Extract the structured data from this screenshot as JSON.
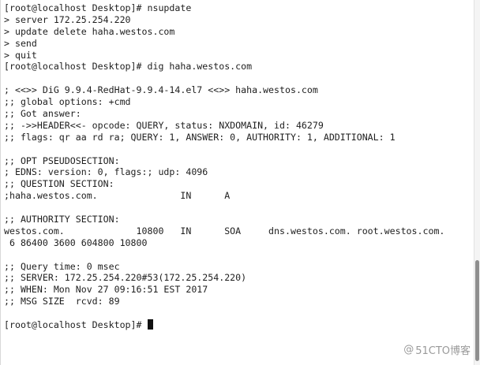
{
  "terminal": {
    "lines": [
      "[root@localhost Desktop]# nsupdate",
      "> server 172.25.254.220",
      "> update delete haha.westos.com",
      "> send",
      "> quit",
      "[root@localhost Desktop]# dig haha.westos.com",
      "",
      "; <<>> DiG 9.9.4-RedHat-9.9.4-14.el7 <<>> haha.westos.com",
      ";; global options: +cmd",
      ";; Got answer:",
      ";; ->>HEADER<<- opcode: QUERY, status: NXDOMAIN, id: 46279",
      ";; flags: qr aa rd ra; QUERY: 1, ANSWER: 0, AUTHORITY: 1, ADDITIONAL: 1",
      "",
      ";; OPT PSEUDOSECTION:",
      "; EDNS: version: 0, flags:; udp: 4096",
      ";; QUESTION SECTION:",
      ";haha.westos.com.\t\tIN\tA",
      "",
      ";; AUTHORITY SECTION:",
      "westos.com.\t\t10800\tIN\tSOA\tdns.westos.com. root.westos.com.",
      " 6 86400 3600 604800 10800",
      "",
      ";; Query time: 0 msec",
      ";; SERVER: 172.25.254.220#53(172.25.254.220)",
      ";; WHEN: Mon Nov 27 09:16:51 EST 2017",
      ";; MSG SIZE  rcvd: 89",
      ""
    ],
    "prompt": "[root@localhost Desktop]# "
  },
  "watermark": {
    "symbol": "@",
    "text": "51CTO博客"
  },
  "colors": {
    "background": "#ffffff",
    "text": "#1e1e1e",
    "cursor": "#111111",
    "scrollbar_thumb": "#8e8e8e"
  }
}
